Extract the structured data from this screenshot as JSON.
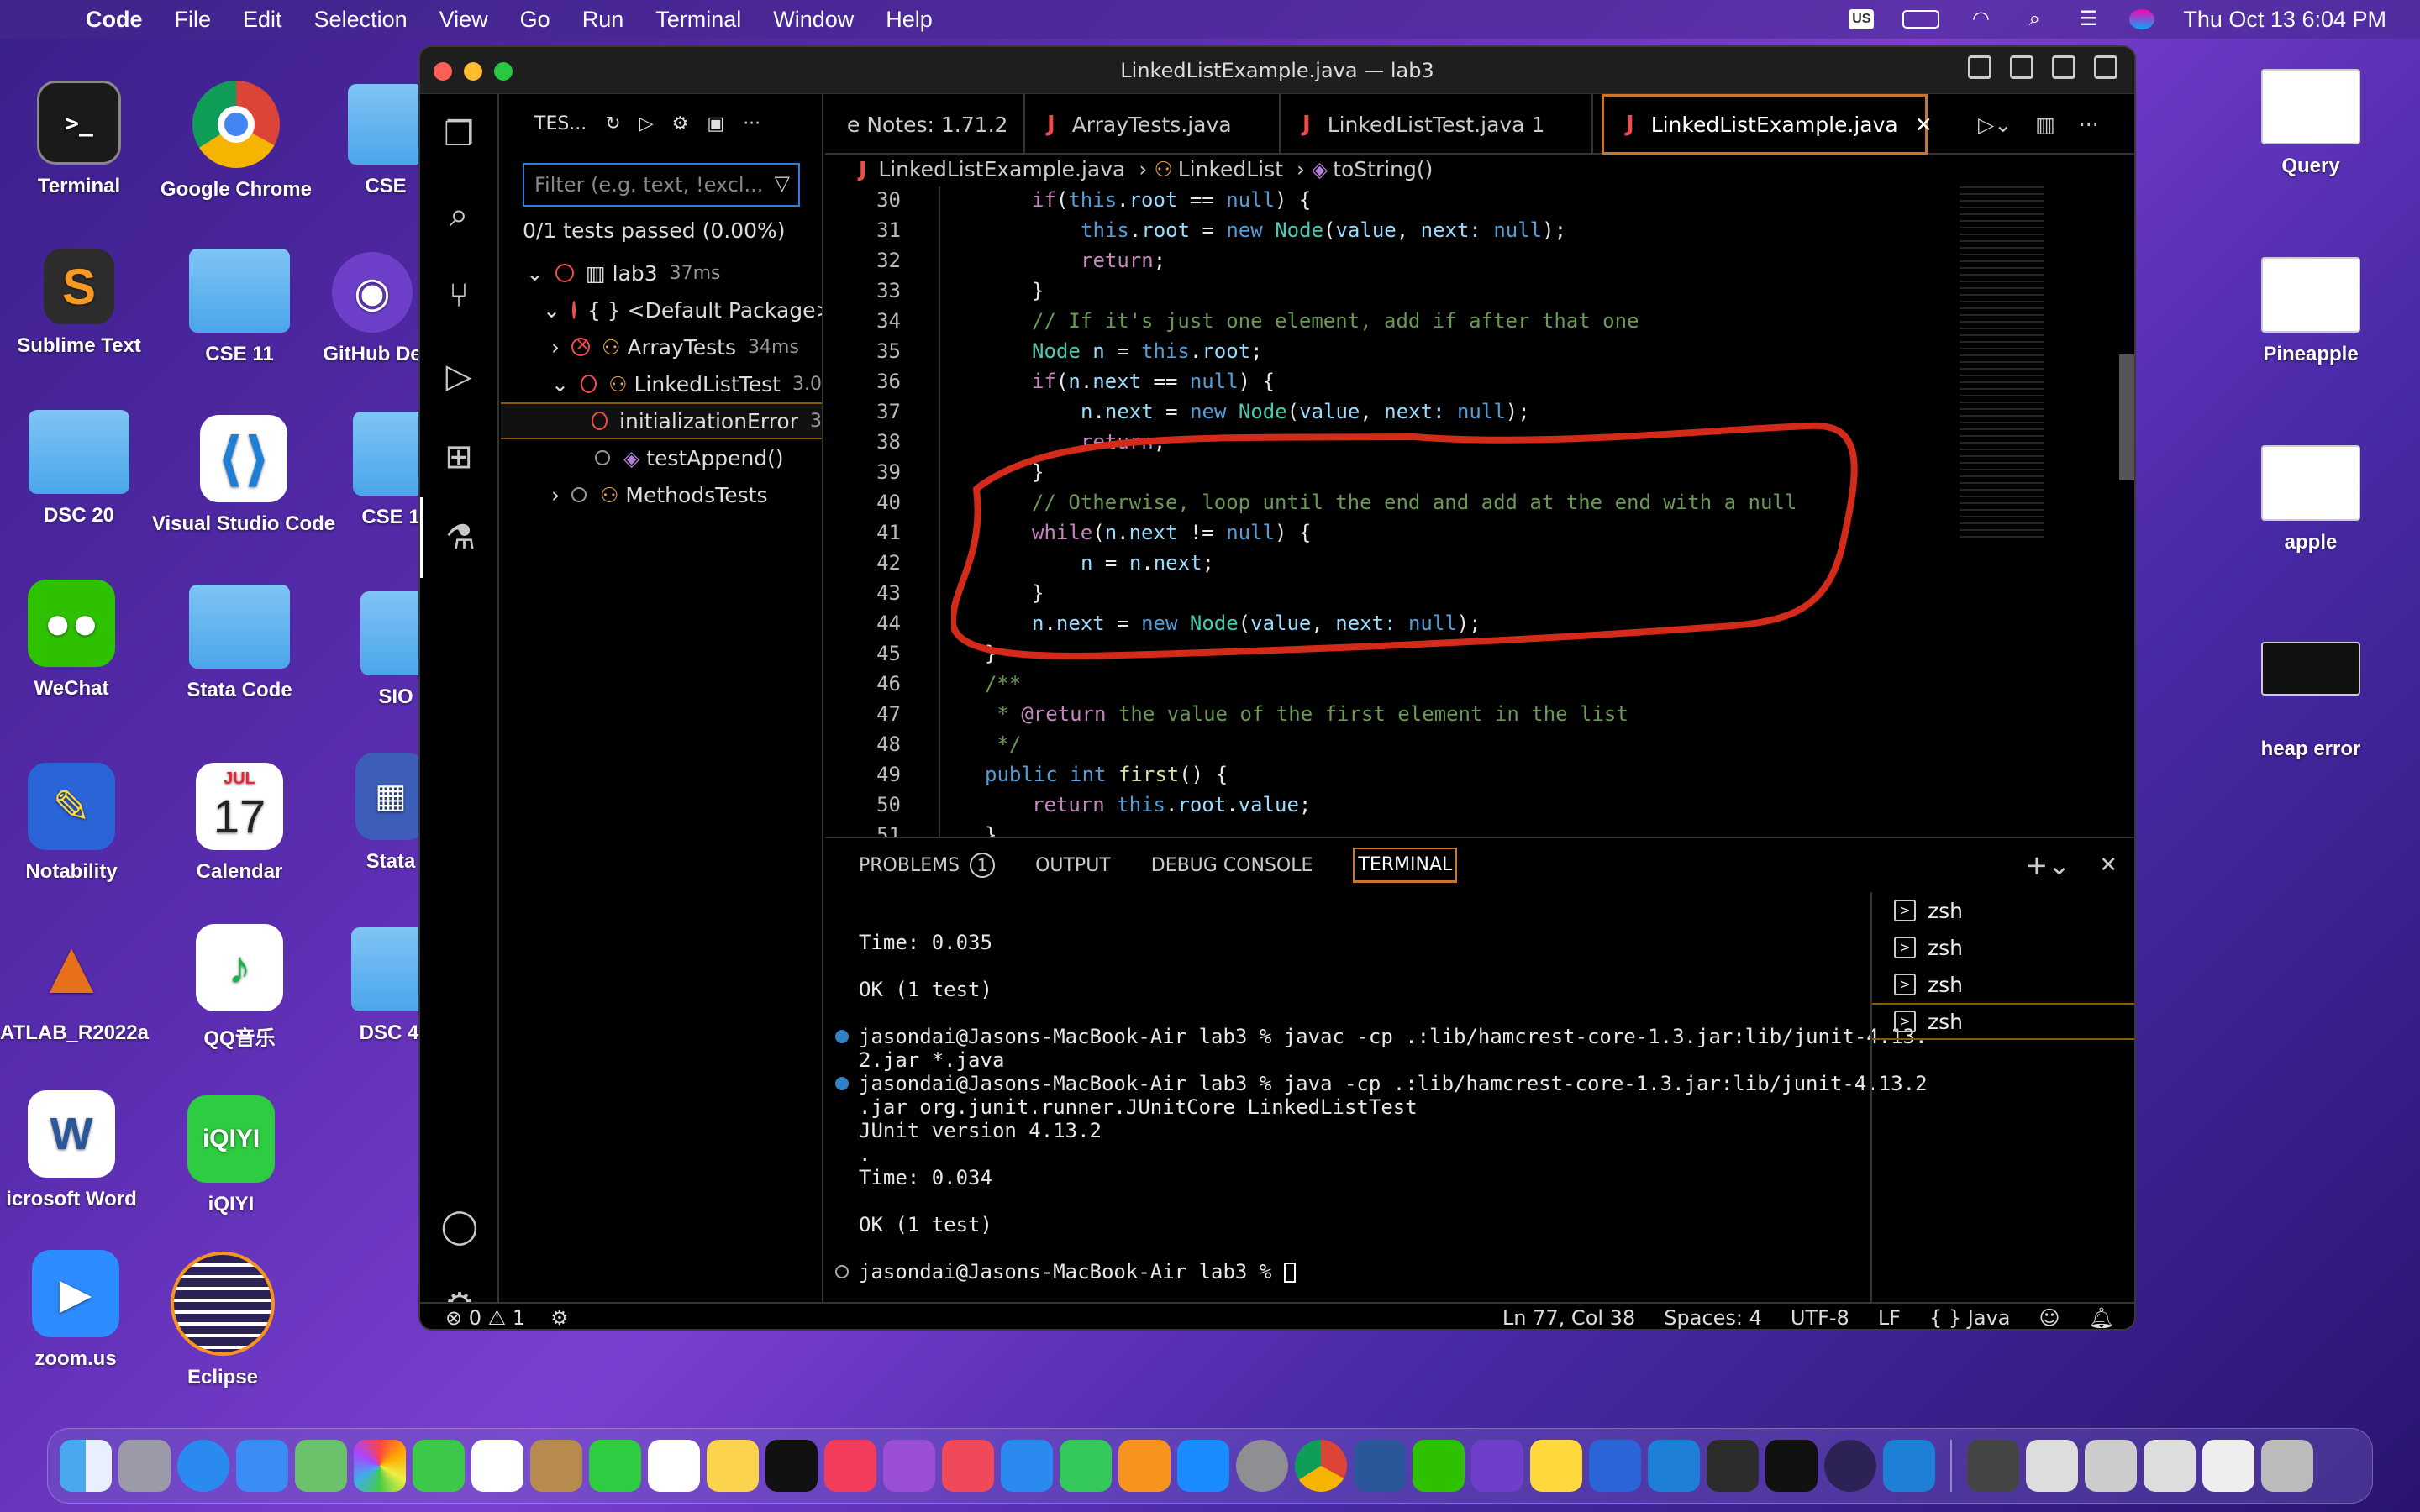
{
  "menubar": {
    "app": "Code",
    "items": [
      "File",
      "Edit",
      "Selection",
      "View",
      "Go",
      "Run",
      "Terminal",
      "Window",
      "Help"
    ],
    "datetime": "Thu Oct 13  6:04 PM",
    "input_source": "US"
  },
  "desktop_left": [
    {
      "label": "Terminal"
    },
    {
      "label": "Google Chrome"
    },
    {
      "label": "CSE"
    },
    {
      "label": "Sublime Text"
    },
    {
      "label": "CSE 11"
    },
    {
      "label": "GitHub De"
    },
    {
      "label": "DSC 20"
    },
    {
      "label": "Visual Studio Code"
    },
    {
      "label": "CSE 1"
    },
    {
      "label": "WeChat"
    },
    {
      "label": "Stata Code"
    },
    {
      "label": "SIO"
    },
    {
      "label": "Notability"
    },
    {
      "label": "Calendar"
    },
    {
      "label": "Stata"
    },
    {
      "label": "ATLAB_R2022a"
    },
    {
      "label": "QQ音乐"
    },
    {
      "label": "DSC 4"
    },
    {
      "label": "icrosoft Word"
    },
    {
      "label": "iQIYI"
    },
    {
      "label": "zoom.us"
    },
    {
      "label": "Eclipse"
    }
  ],
  "calendar_icon": {
    "month": "JUL",
    "day": "17"
  },
  "desktop_right": [
    {
      "label": "Query"
    },
    {
      "label": "Pineapple"
    },
    {
      "label": "apple"
    },
    {
      "label": "heap error"
    }
  ],
  "window": {
    "title": "LinkedListExample.java — lab3"
  },
  "testing": {
    "header": "TES...",
    "filter_placeholder": "Filter (e.g. text, !excl...",
    "summary": "0/1 tests passed (0.00%)",
    "tree": [
      {
        "label": "lab3",
        "time": "37ms"
      },
      {
        "label": "{ } <Default Package>",
        "time": ""
      },
      {
        "label": "ArrayTests",
        "time": "34ms"
      },
      {
        "label": "LinkedListTest",
        "time": "3.0"
      },
      {
        "label": "initializationError",
        "time": "3"
      },
      {
        "label": "testAppend()",
        "time": ""
      },
      {
        "label": "MethodsTests",
        "time": ""
      }
    ]
  },
  "editor": {
    "tabs": [
      {
        "label": "e Notes: 1.71.2"
      },
      {
        "label": "ArrayTests.java"
      },
      {
        "label": "LinkedListTest.java 1"
      },
      {
        "label": "LinkedListExample.java"
      }
    ],
    "breadcrumbs": [
      "LinkedListExample.java",
      "LinkedList",
      "toString()"
    ],
    "line_numbers": [
      "30",
      "31",
      "32",
      "33",
      "34",
      "35",
      "36",
      "37",
      "38",
      "39",
      "40",
      "41",
      "42",
      "43",
      "44",
      "45",
      "46",
      "47",
      "48",
      "49",
      "50",
      "51"
    ]
  },
  "panel": {
    "tabs": [
      "PROBLEMS",
      "OUTPUT",
      "DEBUG CONSOLE",
      "TERMINAL"
    ],
    "problems_count": "1",
    "terminal_lines": [
      "Time: 0.035",
      "OK (1 test)",
      "jasondai@Jasons-MacBook-Air lab3 % javac -cp .:lib/hamcrest-core-1.3.jar:lib/junit-4.13.",
      "2.jar *.java",
      "jasondai@Jasons-MacBook-Air lab3 % java -cp .:lib/hamcrest-core-1.3.jar:lib/junit-4.13.2",
      ".jar org.junit.runner.JUnitCore LinkedListTest",
      "JUnit version 4.13.2",
      ".",
      "Time: 0.034",
      "OK (1 test)",
      "jasondai@Jasons-MacBook-Air lab3 % "
    ],
    "shells": [
      "zsh",
      "zsh",
      "zsh",
      "zsh"
    ]
  },
  "statusbar": {
    "errors": "0",
    "warnings": "1",
    "position": "Ln 77, Col 38",
    "spaces": "Spaces: 4",
    "encoding": "UTF-8",
    "eol": "LF",
    "language": "Java"
  },
  "colors": {
    "accent_orange": "#c9762a",
    "error_red": "#f14c4c",
    "annotation_red": "#d42a1a",
    "focus_blue": "#2b7fd9"
  }
}
